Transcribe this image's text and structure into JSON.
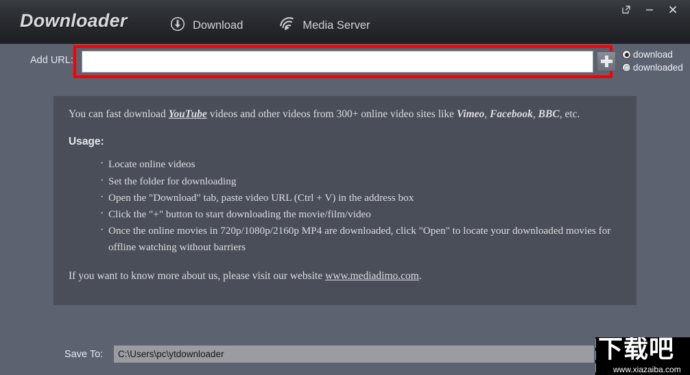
{
  "window": {
    "controls": [
      {
        "name": "restore-window-button",
        "glyph": "restore"
      },
      {
        "name": "minimize-window-button",
        "glyph": "minimize"
      },
      {
        "name": "close-window-button",
        "glyph": "close"
      }
    ]
  },
  "header": {
    "logo": "Downloader",
    "tabs": [
      {
        "label": "Download",
        "icon": "download-circle-icon"
      },
      {
        "label": "Media Server",
        "icon": "cast-wifi-icon"
      }
    ]
  },
  "url_bar": {
    "label": "Add URL:",
    "input_value": "",
    "input_placeholder": "",
    "add_button_label": "+",
    "highlight_color": "#f90000",
    "radios": [
      {
        "label": "download",
        "checked": true
      },
      {
        "label": "downloaded",
        "checked": false
      }
    ]
  },
  "content": {
    "intro": {
      "part1": "You can fast download ",
      "brand1": "YouTube",
      "part2": " videos and other videos from 300+ online video sites like ",
      "brand2": "Vimeo",
      "sep1": ", ",
      "brand3": "Facebook",
      "sep2": ", ",
      "brand4": "BBC",
      "part3": ", etc."
    },
    "usage_title": "Usage:",
    "usage_items": [
      "Locate online videos",
      "Set the folder for downloading",
      "Open the \"Download\" tab, paste video URL (Ctrl + V) in the address box",
      "Click the \"+\" button to start downloading the movie/film/video",
      "Once the online movies in 720p/1080p/2160p MP4 are downloaded, click \"Open\" to locate your downloaded movies for offline watching without barriers"
    ],
    "closing": {
      "text_before": "If you want to know more about us, please visit our website ",
      "link": "www.mediadimo.com",
      "text_after": "."
    }
  },
  "save_bar": {
    "label": "Save To:",
    "path": "C:\\Users\\pc\\ytdownloader"
  },
  "watermark": {
    "cjk": "下载吧",
    "url": "www.xiazaiba.com"
  },
  "colors": {
    "window_background": "#5c6270",
    "header_dark": "#232528",
    "panel_background": "#4a4e58",
    "accent_red": "#f90000",
    "input_white": "#ffffff",
    "path_field_gray": "#9a9ca1"
  }
}
